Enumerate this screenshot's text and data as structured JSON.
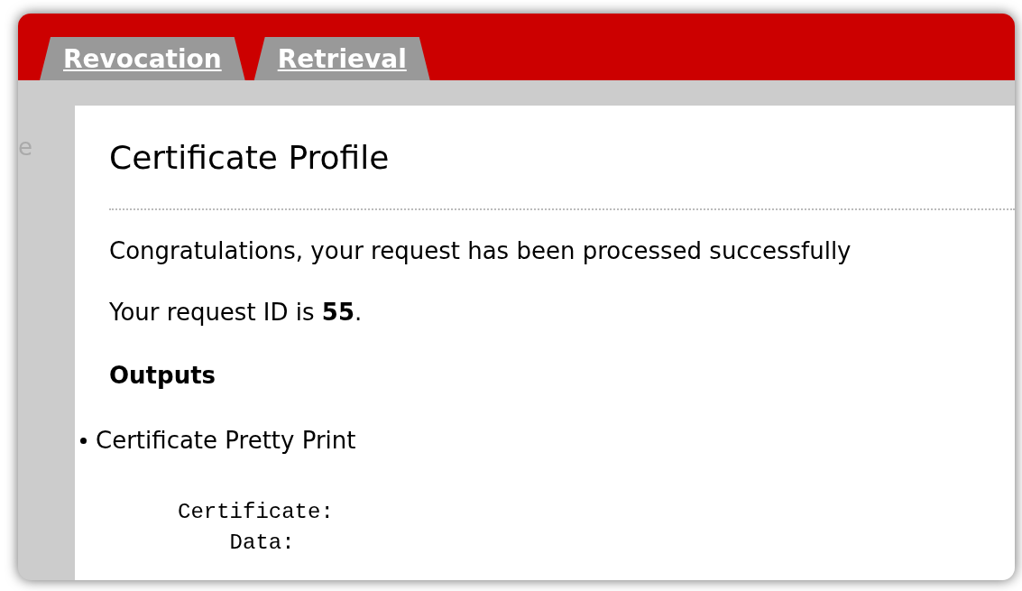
{
  "tabs": [
    {
      "label": "Revocation",
      "selected": false
    },
    {
      "label": "Retrieval",
      "selected": false
    }
  ],
  "sidebar_fragment": "e",
  "content": {
    "title": "Certificate Profile",
    "message": "Congratulations, your request has been processed successfully",
    "request_id": "Your request ID is **55**.",
    "outputs_heading": "Outputs",
    "outputs": [
      {
        "label": "Certificate Pretty Print",
        "lines": [
          "Certificate:",
          "    Data:"
        ]
      }
    ]
  }
}
